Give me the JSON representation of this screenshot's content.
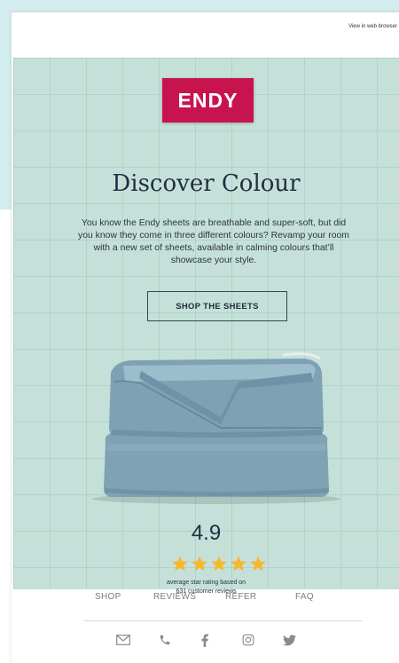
{
  "header": {
    "view_in_browser": "View in web browser"
  },
  "brand": {
    "logo_text": "ENDY",
    "accent_color": "#c8144e"
  },
  "hero": {
    "headline": "Discover Colour",
    "body": "You know the Endy sheets are breathable and super-soft, but did you know they come in three different colours? Revamp your room with a new set of sheets, available in calming colours that’ll showcase your style.",
    "cta_label": "SHOP THE SHEETS",
    "background_color": "#c5e0d8"
  },
  "rating": {
    "value": "4.9",
    "stars": 5,
    "caption_line1": "average star rating based on",
    "caption_line2": "631 customer reviews",
    "star_color": "#f5b82e"
  },
  "footer": {
    "nav": [
      "SHOP",
      "REVIEWS",
      "REFER",
      "FAQ"
    ],
    "social_icons": [
      "email-icon",
      "phone-icon",
      "facebook-icon",
      "instagram-icon",
      "twitter-icon"
    ]
  }
}
